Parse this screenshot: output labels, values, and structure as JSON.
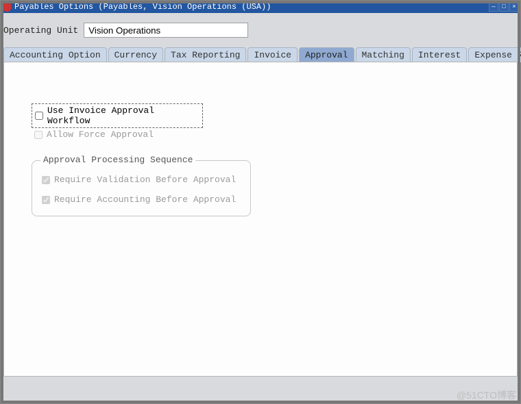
{
  "window": {
    "title": "Payables Options (Payables, Vision Operations (USA))"
  },
  "operating_unit": {
    "label": "Operating Unit",
    "value": "Vision Operations"
  },
  "tabs": [
    {
      "label": "Accounting Option"
    },
    {
      "label": "Currency"
    },
    {
      "label": "Tax Reporting"
    },
    {
      "label": "Invoice"
    },
    {
      "label": "Approval",
      "active": true
    },
    {
      "label": "Matching"
    },
    {
      "label": "Interest"
    },
    {
      "label": "Expense Report"
    }
  ],
  "approval": {
    "use_workflow": {
      "label": "Use Invoice Approval Workflow",
      "checked": false,
      "enabled": true
    },
    "allow_force": {
      "label": "Allow Force Approval",
      "checked": false,
      "enabled": false
    },
    "sequence": {
      "title": "Approval Processing Sequence",
      "require_validation": {
        "label": "Require Validation Before Approval",
        "checked": true,
        "enabled": false
      },
      "require_accounting": {
        "label": "Require Accounting Before Approval",
        "checked": true,
        "enabled": false
      }
    }
  },
  "watermark": "@51CTO博客"
}
